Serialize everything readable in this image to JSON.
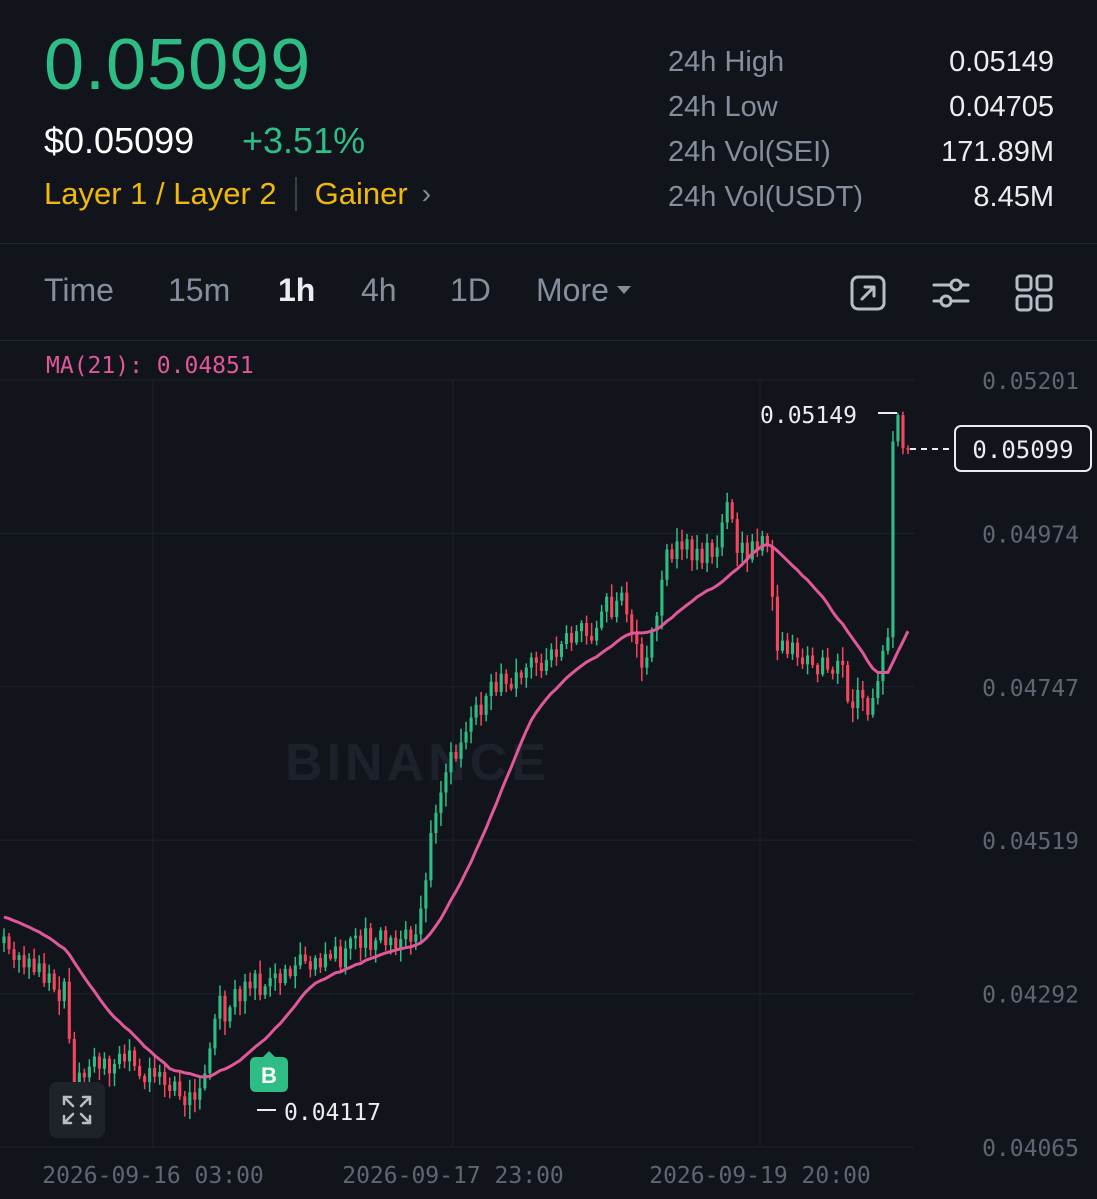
{
  "ticker": {
    "last_price": "0.05099",
    "usd_price": "$0.05099",
    "change_pct": "+3.51%",
    "tag_primary": "Layer 1 / Layer 2",
    "tag_secondary": "Gainer",
    "chevron_icon": "chevron-right-icon"
  },
  "stats": [
    {
      "label": "24h High",
      "value": "0.05149"
    },
    {
      "label": "24h Low",
      "value": "0.04705"
    },
    {
      "label": "24h Vol(SEI)",
      "value": "171.89M"
    },
    {
      "label": "24h Vol(USDT)",
      "value": "8.45M"
    }
  ],
  "toolbar": {
    "intervals": [
      "Time",
      "15m",
      "1h",
      "4h",
      "1D"
    ],
    "active_interval": "1h",
    "more_label": "More",
    "icons": [
      "external-link-icon",
      "sliders-icon",
      "grid-icon"
    ]
  },
  "colors": {
    "up": "#2ebd85",
    "down": "#f6465d",
    "ma_line": "#e0589a",
    "accent": "#f0b90b",
    "background": "#12141c"
  },
  "chart_data": {
    "type": "candlestick",
    "indicator_label": "MA(21): 0.04851",
    "ma_period": 21,
    "ma_current": 0.04851,
    "watermark": "BINANCE",
    "y_ticks": [
      "0.05201",
      "0.04974",
      "0.04747",
      "0.04519",
      "0.04292",
      "0.04065"
    ],
    "ylim": [
      0.04065,
      0.05201
    ],
    "x_ticks": [
      "2026-09-16 03:00",
      "2026-09-17 23:00",
      "2026-09-19 20:00"
    ],
    "high_label": "0.05149",
    "low_label": "0.04117",
    "current_price_label": "0.05099",
    "buy_marker": "B",
    "close_series": [
      0.04377,
      0.04358,
      0.04342,
      0.04349,
      0.04331,
      0.04344,
      0.04324,
      0.04337,
      0.04308,
      0.04322,
      0.04298,
      0.04281,
      0.0431,
      0.04225,
      0.04161,
      0.04175,
      0.04168,
      0.04184,
      0.04199,
      0.04181,
      0.04196,
      0.04174,
      0.04188,
      0.04203,
      0.04192,
      0.04208,
      0.04185,
      0.0417,
      0.04161,
      0.04182,
      0.04169,
      0.04176,
      0.04157,
      0.04148,
      0.04162,
      0.0414,
      0.04127,
      0.04146,
      0.04135,
      0.04152,
      0.04174,
      0.04211,
      0.04255,
      0.04289,
      0.04251,
      0.04272,
      0.04299,
      0.04281,
      0.0431,
      0.043,
      0.04322,
      0.0429,
      0.04303,
      0.04315,
      0.04322,
      0.04308,
      0.04329,
      0.04318,
      0.04334,
      0.0435,
      0.0434,
      0.04328,
      0.04345,
      0.04331,
      0.04351,
      0.04344,
      0.04362,
      0.04331,
      0.04359,
      0.04374,
      0.04378,
      0.0436,
      0.04389,
      0.04357,
      0.04371,
      0.04386,
      0.04364,
      0.04375,
      0.04359,
      0.04373,
      0.04387,
      0.04369,
      0.0438,
      0.04418,
      0.0446,
      0.0453,
      0.0456,
      0.0459,
      0.0462,
      0.0465,
      0.0464,
      0.04664,
      0.0468,
      0.04701,
      0.0472,
      0.04705,
      0.04733,
      0.04754,
      0.04739,
      0.04766,
      0.04751,
      0.04744,
      0.04768,
      0.0476,
      0.04775,
      0.0479,
      0.04782,
      0.0477,
      0.04786,
      0.04802,
      0.04791,
      0.0481,
      0.04826,
      0.04812,
      0.04829,
      0.04841,
      0.04822,
      0.04815,
      0.04834,
      0.04858,
      0.0488,
      0.0485,
      0.04874,
      0.04886,
      0.04854,
      0.04827,
      0.0481,
      0.04775,
      0.0479,
      0.0483,
      0.04852,
      0.04905,
      0.0495,
      0.04936,
      0.04962,
      0.0495,
      0.04965,
      0.04934,
      0.04951,
      0.0493,
      0.0496,
      0.04939,
      0.04953,
      0.0499,
      0.0502,
      0.04995,
      0.04945,
      0.0496,
      0.04935,
      0.04962,
      0.04948,
      0.0497,
      0.04955,
      0.0488,
      0.048,
      0.04815,
      0.04795,
      0.04812,
      0.0479,
      0.0478,
      0.04793,
      0.04779,
      0.04765,
      0.0479,
      0.04772,
      0.04766,
      0.04785,
      0.04779,
      0.04725,
      0.04715,
      0.04742,
      0.0473,
      0.04705,
      0.0473,
      0.04755,
      0.048,
      0.0482,
      0.0511,
      0.05149,
      0.051,
      0.05099
    ]
  }
}
